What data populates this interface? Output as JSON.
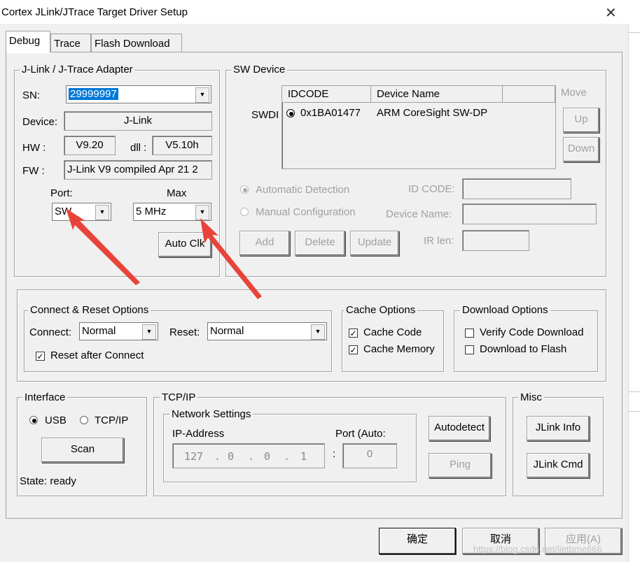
{
  "window": {
    "title": "Cortex JLink/JTrace Target Driver Setup",
    "close_glyph": "✕"
  },
  "tabs": [
    "Debug",
    "Trace",
    "Flash Download"
  ],
  "adapter": {
    "legend": "J-Link / J-Trace Adapter",
    "sn_label": "SN:",
    "sn_value": "29999997",
    "device_label": "Device:",
    "device_value": "J-Link",
    "hw_label": "HW :",
    "hw_value": "V9.20",
    "dll_label": "dll :",
    "dll_value": "V5.10h",
    "fw_label": "FW :",
    "fw_value": "J-Link V9 compiled Apr 21 2",
    "port_label": "Port:",
    "port_value": "SW",
    "max_label": "Max",
    "max_value": "5 MHz",
    "auto_clk": "Auto Clk"
  },
  "sw_device": {
    "legend": "SW Device",
    "swdi_label": "SWDI",
    "columns": [
      "IDCODE",
      "Device Name"
    ],
    "rows": [
      {
        "idcode": "0x1BA01477",
        "device_name": "ARM CoreSight SW-DP"
      }
    ],
    "move_label": "Move",
    "up": "Up",
    "down": "Down",
    "auto_detect": "Automatic Detection",
    "manual_config": "Manual Configuration",
    "id_code_label": "ID CODE:",
    "device_name_label": "Device Name:",
    "ir_len_label": "IR len:",
    "add": "Add",
    "delete": "Delete",
    "update": "Update"
  },
  "connect_reset": {
    "legend": "Connect & Reset Options",
    "connect_label": "Connect:",
    "connect_value": "Normal",
    "reset_label": "Reset:",
    "reset_value": "Normal",
    "reset_after_connect": "Reset after Connect",
    "reset_after_connect_checked": true
  },
  "cache": {
    "legend": "Cache Options",
    "cache_code": "Cache Code",
    "cache_code_checked": true,
    "cache_memory": "Cache Memory",
    "cache_memory_checked": true
  },
  "download": {
    "legend": "Download Options",
    "verify": "Verify Code Download",
    "verify_checked": false,
    "to_flash": "Download to Flash",
    "to_flash_checked": false
  },
  "interface": {
    "legend": "Interface",
    "usb": "USB",
    "tcpip": "TCP/IP",
    "selected": "USB",
    "scan": "Scan",
    "state": "State: ready"
  },
  "tcpip": {
    "legend": "TCP/IP",
    "network_settings": "Network Settings",
    "ip_label": "IP-Address",
    "port_label": "Port (Auto:",
    "ip": [
      "127",
      "0",
      "0",
      "1"
    ],
    "port_value": "0",
    "autodetect": "Autodetect",
    "ping": "Ping"
  },
  "misc": {
    "legend": "Misc",
    "jlink_info": "JLink Info",
    "jlink_cmd": "JLink Cmd"
  },
  "footer": {
    "ok": "确定",
    "cancel": "取消",
    "apply": "应用(A)"
  },
  "watermark": "https://blog.csdn.net/lietbme666",
  "colors": {
    "annotation_arrow": "#e8433a",
    "selection": "#0078d7"
  }
}
